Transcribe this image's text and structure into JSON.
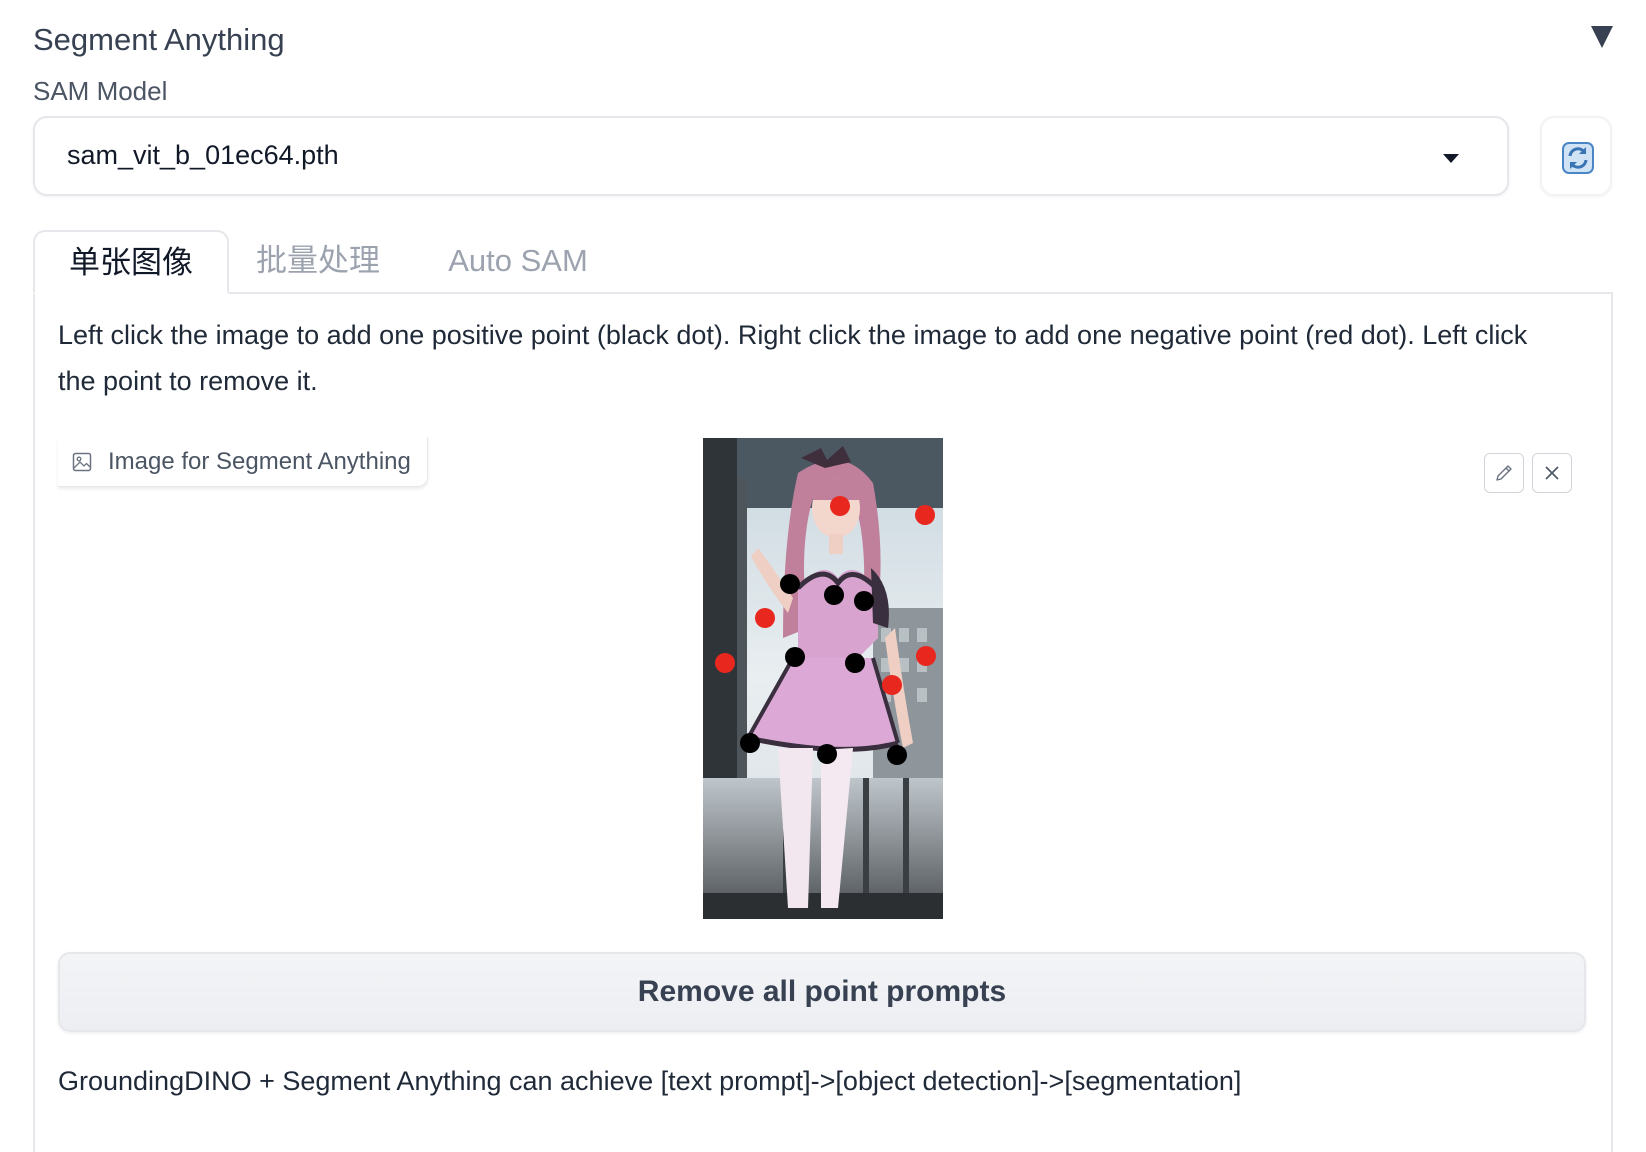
{
  "accordion": {
    "title": "Segment Anything"
  },
  "sam_model": {
    "label": "SAM Model",
    "selected": "sam_vit_b_01ec64.pth"
  },
  "tabs": [
    {
      "label": "单张图像",
      "active": true
    },
    {
      "label": "批量处理",
      "active": false
    },
    {
      "label": "Auto SAM",
      "active": false
    }
  ],
  "instructions": "Left click the image to add one positive point (black dot). Right click the image to add one negative point (red dot). Left click the point to remove it.",
  "image_input": {
    "label": "Image for Segment Anything"
  },
  "point_prompts": {
    "positive_color": "#000000",
    "negative_color": "#e8281e"
  },
  "remove_button": {
    "label": "Remove all point prompts"
  },
  "footer": {
    "text": "GroundingDINO + Segment Anything can achieve [text prompt]->[object detection]->[segmentation]"
  },
  "colors": {
    "border": "#e5e7eb",
    "muted_text": "#9ca3af",
    "refresh_icon_blue": "#3b82c4"
  }
}
